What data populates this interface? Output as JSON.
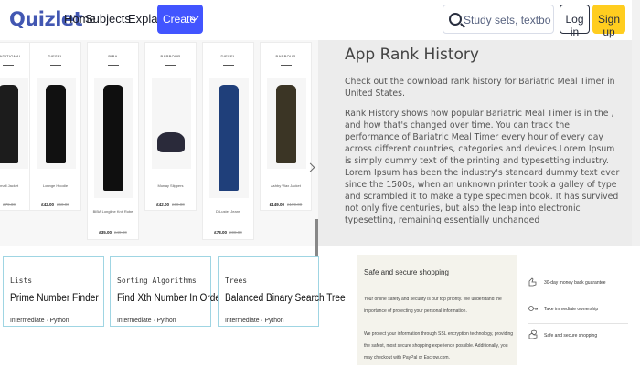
{
  "header": {
    "logo": "Quizlet",
    "nav": [
      "Home",
      "Subjects",
      "Explanations"
    ],
    "create_label": "Create",
    "search_placeholder": "Study sets, textbooks, ...",
    "login_label": "Log in",
    "signup_label": "Sign up"
  },
  "products": [
    {
      "brand": "TRADITIONAL",
      "name": "...mall Jacket",
      "price": "",
      "old_price": "£79.00",
      "color": "#1c1c1c"
    },
    {
      "brand": "DIESEL",
      "name": "Lounge Hoodie",
      "price": "£42.00",
      "old_price": "£60.00",
      "color": "#111111"
    },
    {
      "brand": "BIBA",
      "name": "BIBA Longline Knit Robe",
      "price": "£35.00",
      "old_price": "£49.00",
      "color": "#0f0f0f"
    },
    {
      "brand": "BARBOUR",
      "name": "Murray Slippers",
      "price": "£42.00",
      "old_price": "£60.00",
      "color": "#2a2a3a"
    },
    {
      "brand": "DIESEL",
      "name": "D Luster Jeans",
      "price": "£78.00",
      "old_price": "£98.00",
      "color": "#1f3f7a"
    },
    {
      "brand": "BARBOUR",
      "name": "Ashby Wax Jacket",
      "price": "£149.00",
      "old_price": "£199.00",
      "color": "#3b3525"
    }
  ],
  "rank": {
    "title": "App Rank History",
    "intro": "Check out the download rank history for Bariatric Meal Timer in United States.",
    "body": "Rank History shows how popular Bariatric Meal Timer is in the , and how that's changed over time. You can track the performance of Bariatric Meal Timer every hour of every day across different countries, categories and devices.Lorem Ipsum is simply dummy text of the printing and typesetting industry. Lorem Ipsum has been the industry's standard dummy text ever since the 1500s, when an unknown printer took a galley of type and scrambled it to make a type specimen book. It has survived not only five centuries, but also the leap into electronic typesetting, remaining essentially unchanged"
  },
  "problems": [
    {
      "category": "Lists",
      "title": "Prime Number Finder",
      "meta": "Intermediate · Python"
    },
    {
      "category": "Sorting Algorithms",
      "title": "Find Xth Number In Order",
      "meta": "Intermediate · Python"
    },
    {
      "category": "Trees",
      "title": "Balanced Binary Search Tree",
      "meta": "Intermediate · Python"
    }
  ],
  "safe": {
    "title": "Safe and secure shopping",
    "p1": "Your online safety and security is our top priority. We understand the importance of protecting your personal information.",
    "p2": "We protect your information through SSL encryption technology, providing the safest, most secure shopping experience possible. Additionally, you may checkout with PayPal or Escrow.com.",
    "features": [
      "30-day money back guarantee",
      "Take immediate ownership",
      "Safe and secure shopping"
    ]
  }
}
